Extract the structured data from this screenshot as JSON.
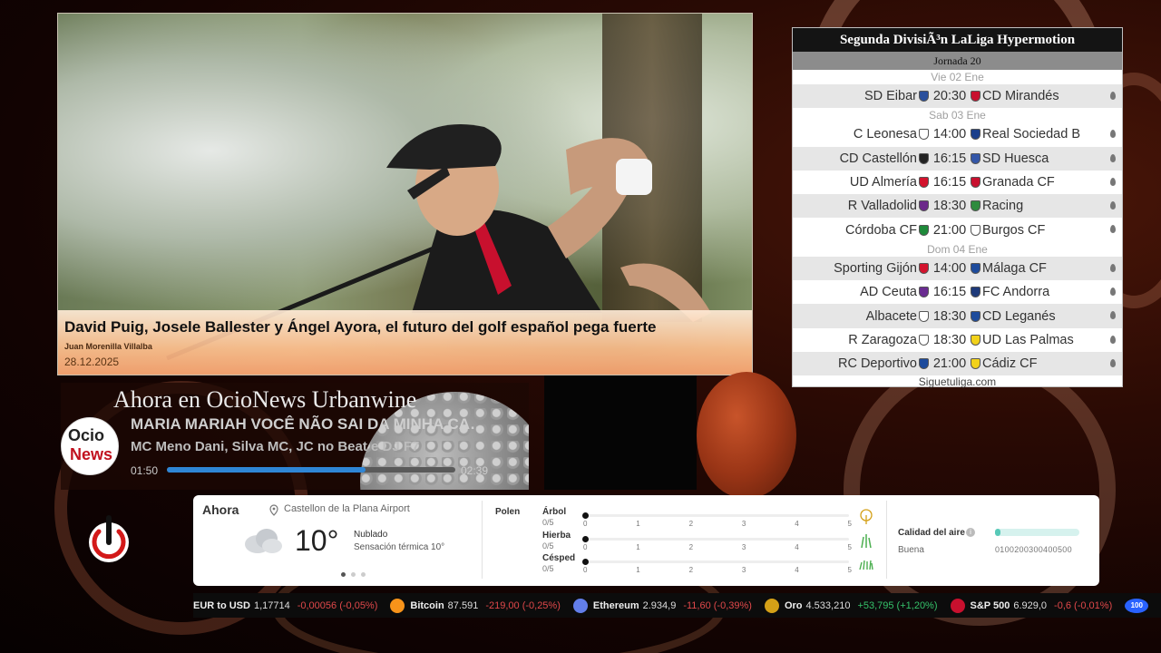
{
  "hero": {
    "title": "David Puig, Josele Ballester y Ángel Ayora, el futuro del golf español pega fuerte",
    "author": "Juan Morenilla Villalba",
    "date": "28.12.2025"
  },
  "league": {
    "title": "Segunda DivisiÃ³n LaLiga Hypermotion",
    "matchday": "Jornada 20",
    "footer": "Siguetuliga.com",
    "days": [
      {
        "date": "Vie 02 Ene",
        "matches": [
          {
            "home": "SD Eibar",
            "time": "20:30",
            "away": "CD Mirandés",
            "home_color": "#2a4f9c",
            "away_color": "#c8102e"
          }
        ]
      },
      {
        "date": "Sab 03 Ene",
        "matches": [
          {
            "home": "C Leonesa",
            "time": "14:00",
            "away": "Real Sociedad B",
            "home_color": "#ffffff",
            "away_color": "#1b3f8b"
          },
          {
            "home": "CD Castellón",
            "time": "16:15",
            "away": "SD Huesca",
            "home_color": "#222222",
            "away_color": "#3356a8"
          },
          {
            "home": "UD Almería",
            "time": "16:15",
            "away": "Granada CF",
            "home_color": "#d3132d",
            "away_color": "#c8102e"
          },
          {
            "home": "R Valladolid",
            "time": "18:30",
            "away": "Racing",
            "home_color": "#6c2a8a",
            "away_color": "#2e8b3e"
          },
          {
            "home": "Córdoba CF",
            "time": "21:00",
            "away": "Burgos CF",
            "home_color": "#1e8a3a",
            "away_color": "#ffffff"
          }
        ]
      },
      {
        "date": "Dom 04 Ene",
        "matches": [
          {
            "home": "Sporting Gijón",
            "time": "14:00",
            "away": "Málaga CF",
            "home_color": "#d3132d",
            "away_color": "#1d4b9c"
          },
          {
            "home": "AD Ceuta",
            "time": "16:15",
            "away": "FC Andorra",
            "home_color": "#6a2c91",
            "away_color": "#1e3a7a"
          },
          {
            "home": "Albacete",
            "time": "18:30",
            "away": "CD Leganés",
            "home_color": "#ffffff",
            "away_color": "#1d4b9c"
          },
          {
            "home": "R Zaragoza",
            "time": "18:30",
            "away": "UD Las Palmas",
            "home_color": "#ffffff",
            "away_color": "#f2d21b"
          },
          {
            "home": "RC Deportivo",
            "time": "21:00",
            "away": "Cádiz CF",
            "home_color": "#1d4b9c",
            "away_color": "#f2d21b"
          }
        ]
      }
    ]
  },
  "player": {
    "heading": "Ahora en OcioNews Urbanwine",
    "logo_top": "Ocio",
    "logo_bottom": "News",
    "song": "MARIA MARIAH VOCÊ NÃO SAI DA MINHA CABEÇA",
    "artist": "MC Meno Dani, Silva MC, JC no Beat e DJ F7",
    "current_time": "01:50",
    "total_time": "02:39",
    "progress": 0.69
  },
  "weather": {
    "now_label": "Ahora",
    "location": "Castellon de la Plana Airport",
    "temperature": "10°",
    "condition": "Nublado",
    "feels_like": "Sensación térmica 10°",
    "icon": "cloud-icon",
    "pollen_label": "Polen",
    "pollen": [
      {
        "name": "Árbol",
        "value": "0/5",
        "level": 0,
        "icon": "tree-icon"
      },
      {
        "name": "Hierba",
        "value": "0/5",
        "level": 0,
        "icon": "grass-icon"
      },
      {
        "name": "Césped",
        "value": "0/5",
        "level": 0,
        "icon": "lawn-icon"
      }
    ],
    "scale": [
      "0",
      "1",
      "2",
      "3",
      "4",
      "5"
    ],
    "air_quality_label": "Calidad del aire",
    "air_quality_status": "Buena",
    "air_quality_scale": "0100200300400500",
    "air_quality_level": 0.06,
    "accent": "#58c9b8"
  },
  "ticker": [
    {
      "name": "EUR to USD",
      "price": "1,17714",
      "change": "-0,00056 (-0,05%)",
      "icon": "",
      "color": "",
      "dir": "down"
    },
    {
      "name": "Bitcoin",
      "price": "87.591",
      "change": "-219,00 (-0,25%)",
      "icon": "bitcoin-icon",
      "color": "#f7931a",
      "dir": "down"
    },
    {
      "name": "Ethereum",
      "price": "2.934,9",
      "change": "-11,60 (-0,39%)",
      "icon": "ethereum-icon",
      "color": "#627eea",
      "dir": "down"
    },
    {
      "name": "Oro",
      "price": "4.533,210",
      "change": "+53,795 (+1,20%)",
      "icon": "gold-icon",
      "color": "#d4a017",
      "dir": "up"
    },
    {
      "name": "S&P 500",
      "price": "6.929,0",
      "change": "-0,6 (-0,01%)",
      "icon": "sp500-icon",
      "color": "#c8102e",
      "dir": "down"
    },
    {
      "name": "",
      "price": "",
      "change": "",
      "icon": "tv-icon",
      "color": "#2962ff",
      "dir": "down",
      "badge": "100"
    }
  ]
}
